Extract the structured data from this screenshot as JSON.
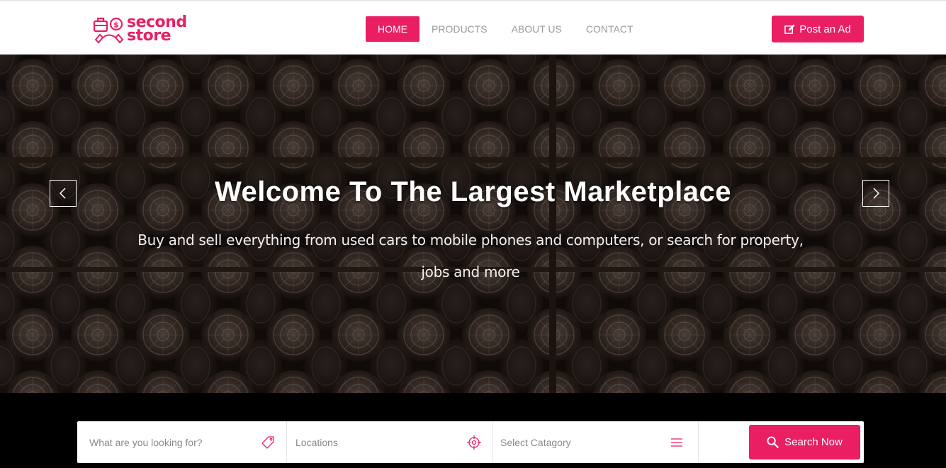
{
  "brand": {
    "name_line1": "second",
    "name_line2": "store",
    "accent": "#e91e63"
  },
  "nav": {
    "items": [
      {
        "label": "HOME",
        "active": true
      },
      {
        "label": "PRODUCTS",
        "active": false
      },
      {
        "label": "ABOUT US",
        "active": false
      },
      {
        "label": "CONTACT",
        "active": false
      }
    ],
    "post_ad_label": "Post an Ad",
    "post_ad_icon": "edit-icon"
  },
  "hero": {
    "title": "Welcome To The Largest Marketplace",
    "subtitle": "Buy and sell everything from used cars to mobile phones and computers, or search for property, jobs and more",
    "prev_icon": "chevron-left-icon",
    "next_icon": "chevron-right-icon"
  },
  "search": {
    "keyword_placeholder": "What are you looking for?",
    "keyword_icon": "tag-icon",
    "location_placeholder": "Locations",
    "location_icon": "crosshair-icon",
    "category_label": "Select Catagory",
    "category_icon": "menu-icon",
    "button_label": "Search Now",
    "button_icon": "search-icon"
  }
}
